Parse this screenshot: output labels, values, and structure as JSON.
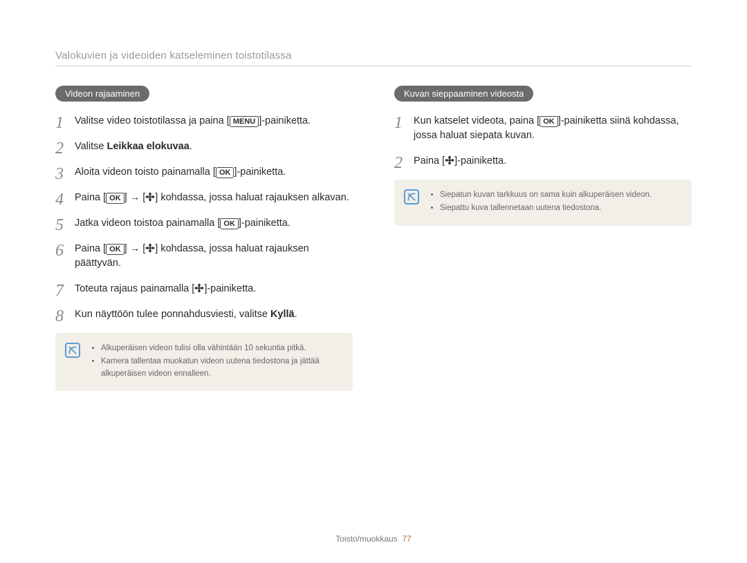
{
  "breadcrumb": "Valokuvien ja videoiden katseleminen toistotilassa",
  "left": {
    "heading": "Videon rajaaminen",
    "steps": [
      {
        "pre": "Valitse video toistotilassa ja paina [",
        "key": "MENU",
        "post": "]-painiketta."
      },
      {
        "plainPre": "Valitse ",
        "bold": "Leikkaa elokuvaa",
        "plainPost": "."
      },
      {
        "pre": "Aloita videon toisto painamalla [",
        "key": "OK",
        "post": "]-painiketta."
      },
      {
        "pre": "Paina [",
        "key": "OK",
        "mid": "] → [",
        "icon": "flower",
        "post2": "] kohdassa, jossa haluat rajauksen alkavan."
      },
      {
        "pre": "Jatka videon toistoa painamalla [",
        "key": "OK",
        "post": "]-painiketta."
      },
      {
        "pre": "Paina [",
        "key": "OK",
        "mid": "] → [",
        "icon": "flower",
        "post2": "] kohdassa, jossa haluat rajauksen päättyvän."
      },
      {
        "plainPre": "Toteuta rajaus painamalla [",
        "icon": "flower",
        "plainPost": "]-painiketta."
      },
      {
        "plainPre": "Kun näyttöön tulee ponnahdusviesti, valitse ",
        "bold": "Kyllä",
        "plainPost": "."
      }
    ],
    "notes": [
      "Alkuperäisen videon tulisi olla vähintään 10 sekuntia pitkä.",
      "Kamera tallentaa muokatun videon uutena tiedostona ja jättää alkuperäisen videon ennalleen."
    ]
  },
  "right": {
    "heading": "Kuvan sieppaaminen videosta",
    "steps": [
      {
        "pre": "Kun katselet videota, paina [",
        "key": "OK",
        "post": "]-painiketta siinä kohdassa, jossa haluat siepata kuvan."
      },
      {
        "plainPre": "Paina [",
        "icon": "flower",
        "plainPost": "]-painiketta."
      }
    ],
    "notes": [
      "Siepatun kuvan tarkkuus on sama kuin alkuperäisen videon.",
      "Siepattu kuva tallennetaan uutena tiedostona."
    ]
  },
  "footer": {
    "section": "Toisto/muokkaus",
    "page": "77"
  }
}
